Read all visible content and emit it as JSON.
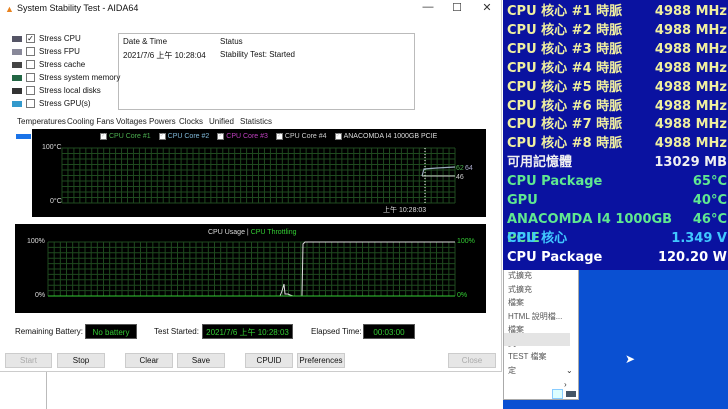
{
  "window": {
    "title": "System Stability Test - AIDA64",
    "minimize": "—",
    "maximize": "☐",
    "close": "✕"
  },
  "stress": [
    {
      "label": "Stress CPU",
      "checked": true
    },
    {
      "label": "Stress FPU",
      "checked": false
    },
    {
      "label": "Stress cache",
      "checked": false
    },
    {
      "label": "Stress system memory",
      "checked": false
    },
    {
      "label": "Stress local disks",
      "checked": false
    },
    {
      "label": "Stress GPU(s)",
      "checked": false
    }
  ],
  "log": {
    "col_date": "Date & Time",
    "col_status": "Status",
    "rows": [
      {
        "date": "2021/7/6 上午 10:28:04",
        "status": "Stability Test: Started"
      }
    ]
  },
  "tabs": [
    "Temperatures",
    "Cooling Fans",
    "Voltages",
    "Powers",
    "Clocks",
    "Unified",
    "Statistics"
  ],
  "temp_chart": {
    "legend": [
      {
        "label": "CPU Core #1",
        "color": "#4caf50"
      },
      {
        "label": "CPU Core #2",
        "color": "#7fb8d8"
      },
      {
        "label": "CPU Core #3",
        "color": "#c040c0"
      },
      {
        "label": "CPU Core #4",
        "color": "#cccccc"
      },
      {
        "label": "ANACOMDA I4 1000GB PCIE",
        "color": "#dddddd"
      }
    ],
    "y_top": "100°C",
    "y_bottom": "0°C",
    "time_label": "上午 10:28:03",
    "value_a": "62",
    "value_b": "64",
    "value_c": "46"
  },
  "usage_chart": {
    "title_usage": "CPU Usage",
    "sep": "|",
    "title_throttle": "CPU Throttling",
    "left_top": "100%",
    "left_bottom": "0%",
    "right_top": "100%",
    "right_bottom": "0%"
  },
  "status": {
    "battery_label": "Remaining Battery:",
    "battery": "No battery",
    "started_label": "Test Started:",
    "started": "2021/7/6 上午 10:28:03",
    "elapsed_label": "Elapsed Time:",
    "elapsed": "00:03:00"
  },
  "buttons": {
    "start": "Start",
    "stop": "Stop",
    "clear": "Clear",
    "save": "Save",
    "cpuid": "CPUID",
    "preferences": "Preferences",
    "close": "Close"
  },
  "osd": [
    {
      "label": "CPU 核心 #1 時脈",
      "value": "4988 MHz",
      "color": "#f0f0a0"
    },
    {
      "label": "CPU 核心 #2 時脈",
      "value": "4988 MHz",
      "color": "#f0f0a0"
    },
    {
      "label": "CPU 核心 #3 時脈",
      "value": "4988 MHz",
      "color": "#f0f0a0"
    },
    {
      "label": "CPU 核心 #4 時脈",
      "value": "4988 MHz",
      "color": "#f0f0a0"
    },
    {
      "label": "CPU 核心 #5 時脈",
      "value": "4988 MHz",
      "color": "#f0f0a0"
    },
    {
      "label": "CPU 核心 #6 時脈",
      "value": "4988 MHz",
      "color": "#f0f0a0"
    },
    {
      "label": "CPU 核心 #7 時脈",
      "value": "4988 MHz",
      "color": "#f0f0a0"
    },
    {
      "label": "CPU 核心 #8 時脈",
      "value": "4988 MHz",
      "color": "#f0f0a0"
    },
    {
      "label": "可用記憶體",
      "value": "13029 MB",
      "color": "#f0f0f0"
    },
    {
      "label": "CPU Package",
      "value": "65°C",
      "color": "#60e890"
    },
    {
      "label": "GPU",
      "value": "40°C",
      "color": "#60e890"
    },
    {
      "label": "ANACOMDA I4 1000GB PCIE",
      "value": "46°C",
      "color": "#60e890"
    },
    {
      "label": "CPU 核心",
      "value": "1.349 V",
      "color": "#40c8ff"
    },
    {
      "label": "CPU Package",
      "value": "120.20 W",
      "color": "#ffffff"
    }
  ],
  "menu": [
    "式擴充",
    "式擴充",
    "檔案",
    "HTML 說明檔...",
    "檔案",
    "式",
    "TEST 檔案",
    "定"
  ]
}
